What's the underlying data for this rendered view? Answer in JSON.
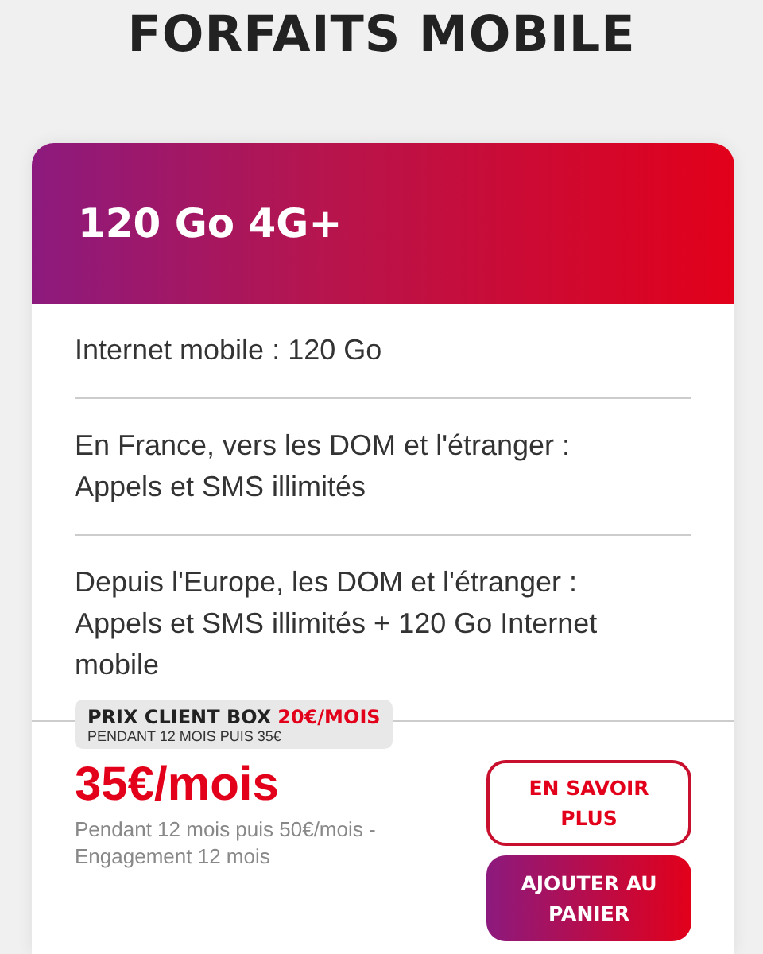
{
  "page_title": "FORFAITS MOBILE",
  "plan": {
    "name": "120 Go 4G+",
    "features": [
      "Internet mobile : 120 Go",
      "En France, vers les DOM et l'étranger : Appels et SMS illimités",
      "Depuis l'Europe, les DOM et l'étranger : Appels et SMS illimités + 120 Go Internet mobile"
    ],
    "promo": {
      "label": "PRIX CLIENT BOX",
      "highlight": "20€/MOIS",
      "note": "PENDANT 12 MOIS PUIS 35€"
    },
    "price": "35€/mois",
    "price_note": "Pendant 12 mois puis 50€/mois - Engagement 12 mois",
    "buttons": [
      {
        "label": "EN SAVOIR PLUS",
        "kind": "outline"
      },
      {
        "label": "AJOUTER AU PANIER",
        "kind": "filled"
      }
    ]
  }
}
